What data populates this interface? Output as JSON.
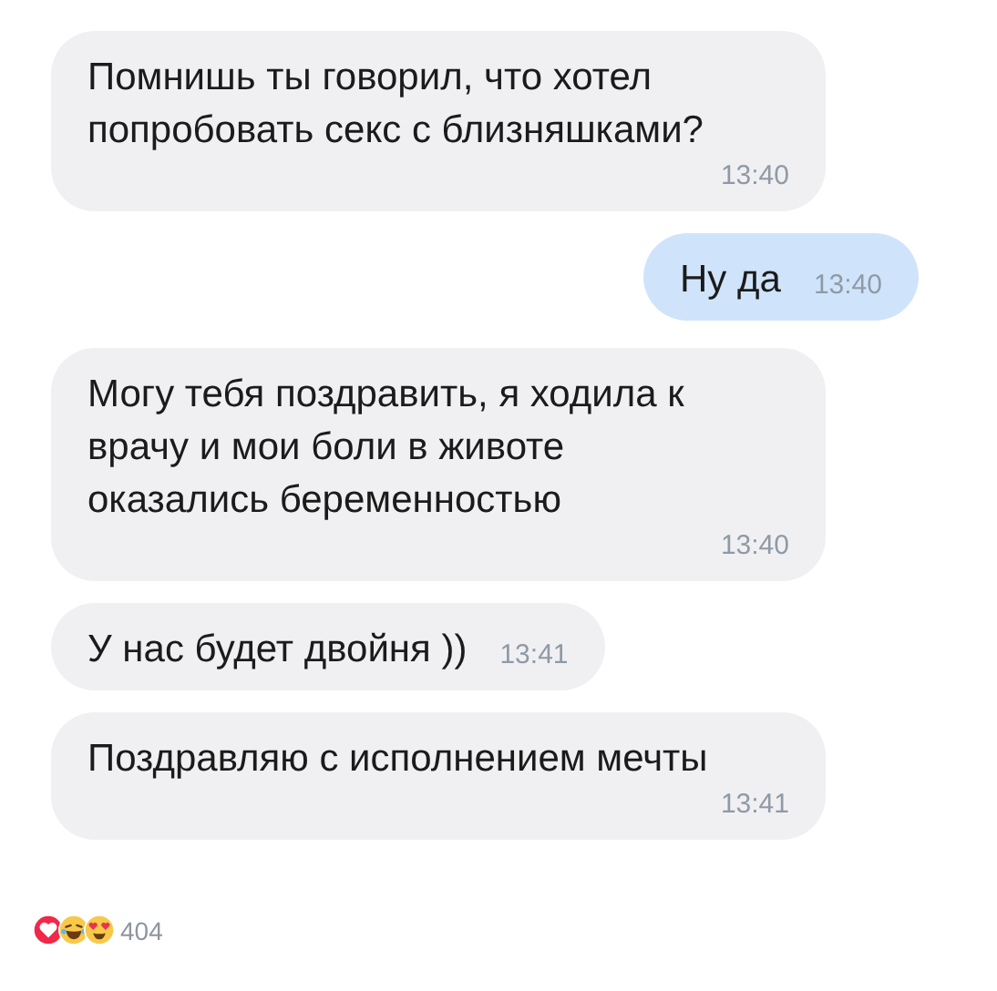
{
  "messages": [
    {
      "text": "Помнишь ты говорил, что хотел попробовать секс с близняшками?",
      "time": "13:40",
      "outgoing": false
    },
    {
      "text": "Ну да",
      "time": "13:40",
      "outgoing": true
    },
    {
      "text": "Могу тебя поздравить, я ходила к врачу и мои боли в животе оказались беременностью",
      "time": "13:40",
      "outgoing": false
    },
    {
      "text": "У нас будет двойня ))",
      "time": "13:41",
      "outgoing": false
    },
    {
      "text": "Поздравляю с исполнением мечты",
      "time": "13:41",
      "outgoing": false
    }
  ],
  "reactions": {
    "count": "404"
  }
}
